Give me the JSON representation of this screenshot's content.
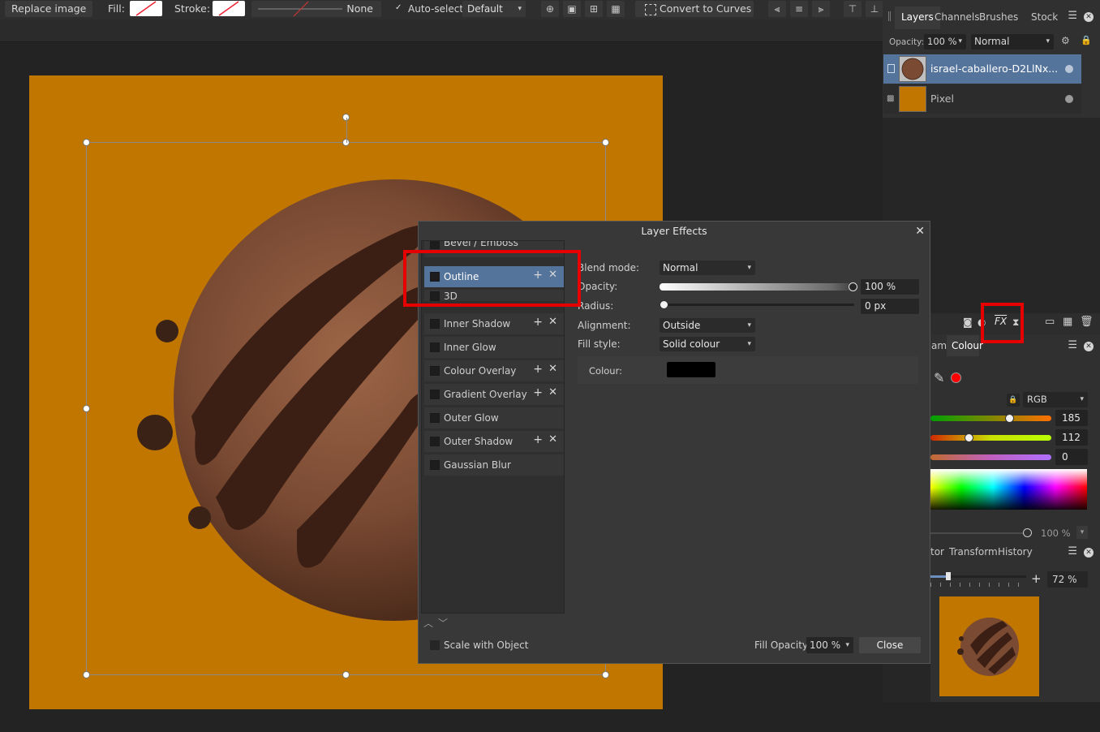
{
  "toolbar": {
    "replace_image": "Replace image",
    "fill_label": "Fill:",
    "stroke_label": "Stroke:",
    "line_style_value": "None",
    "auto_select_label": "Auto-select:",
    "auto_select_value": "Default",
    "convert_to_curves": "Convert to Curves"
  },
  "layers_panel": {
    "tabs": [
      "Layers",
      "Channels",
      "Brushes",
      "Stock"
    ],
    "opacity_label": "Opacity:",
    "opacity_value": "100 %",
    "blend_value": "Normal",
    "layers": [
      {
        "name": "israel-caballero-D2LlNx...",
        "selected": true
      },
      {
        "name": "Pixel",
        "selected": false
      }
    ]
  },
  "colour_panel": {
    "tabs": [
      "am",
      "Colour"
    ],
    "model": "RGB",
    "r": "185",
    "g": "112",
    "b": "0",
    "opacity": "100 %"
  },
  "nav_panel": {
    "tabs": [
      "tor",
      "Transform",
      "History"
    ],
    "zoom": "72 %"
  },
  "dialog": {
    "title": "Layer Effects",
    "effects": [
      {
        "label": "Bevel / Emboss",
        "has_controls": false,
        "selected": false
      },
      {
        "label": "Outline",
        "has_controls": true,
        "selected": true
      },
      {
        "label": "3D",
        "has_controls": false,
        "selected": false
      },
      {
        "label": "Inner Shadow",
        "has_controls": true,
        "selected": false
      },
      {
        "label": "Inner Glow",
        "has_controls": false,
        "selected": false
      },
      {
        "label": "Colour Overlay",
        "has_controls": true,
        "selected": false
      },
      {
        "label": "Gradient Overlay",
        "has_controls": true,
        "selected": false
      },
      {
        "label": "Outer Glow",
        "has_controls": false,
        "selected": false
      },
      {
        "label": "Outer Shadow",
        "has_controls": true,
        "selected": false
      },
      {
        "label": "Gaussian Blur",
        "has_controls": false,
        "selected": false
      }
    ],
    "settings": {
      "blend_mode_label": "Blend mode:",
      "blend_mode_value": "Normal",
      "opacity_label": "Opacity:",
      "opacity_value": "100 %",
      "opacity_level": 1.0,
      "radius_label": "Radius:",
      "radius_value": "0 px",
      "radius_level": 0,
      "alignment_label": "Alignment:",
      "alignment_value": "Outside",
      "fill_style_label": "Fill style:",
      "fill_style_value": "Solid colour",
      "colour_label": "Colour:",
      "colour_value": "#000000"
    },
    "scale_with_object": "Scale with Object",
    "fill_opacity_label": "Fill Opacity:",
    "fill_opacity_value": "100 %",
    "close_button": "Close"
  },
  "colors": {
    "canvas_background": "#c17600",
    "selection_accent": "#55749c",
    "highlight_red": "#e60000"
  }
}
